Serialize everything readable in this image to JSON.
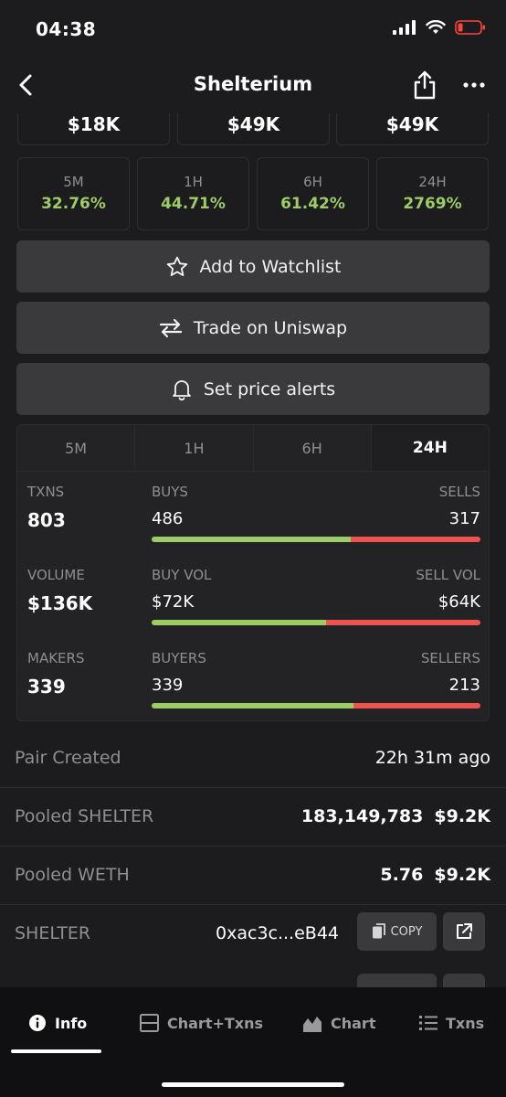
{
  "status_bar": {
    "time": "04:38"
  },
  "header": {
    "title": "Shelterium"
  },
  "prices": [
    "$18K",
    "$49K",
    "$49K"
  ],
  "changes": [
    {
      "label": "5M",
      "value": "32.76%"
    },
    {
      "label": "1H",
      "value": "44.71%"
    },
    {
      "label": "6H",
      "value": "61.42%"
    },
    {
      "label": "24H",
      "value": "2769%"
    }
  ],
  "actions": {
    "watchlist": "Add to Watchlist",
    "trade": "Trade on Uniswap",
    "alerts": "Set price alerts"
  },
  "tx_tabs": [
    "5M",
    "1H",
    "6H",
    "24H"
  ],
  "tx_active_tab": "24H",
  "tx_rows": [
    {
      "left_label": "TXNS",
      "left_value": "803",
      "mid_label": "BUYS",
      "mid_value": "486",
      "right_label": "SELLS",
      "right_value": "317",
      "buy_fraction": 0.605
    },
    {
      "left_label": "VOLUME",
      "left_value": "$136K",
      "mid_label": "BUY VOL",
      "mid_value": "$72K",
      "right_label": "SELL VOL",
      "right_value": "$64K",
      "buy_fraction": 0.53
    },
    {
      "left_label": "MAKERS",
      "left_value": "339",
      "mid_label": "BUYERS",
      "mid_value": "339",
      "right_label": "SELLERS",
      "right_value": "213",
      "buy_fraction": 0.614
    }
  ],
  "info": {
    "pair_created_label": "Pair Created",
    "pair_created_value": "22h 31m ago",
    "pooled_shelter_label": "Pooled SHELTER",
    "pooled_shelter_amount": "183,149,783",
    "pooled_shelter_usd": "$9.2K",
    "pooled_weth_label": "Pooled WETH",
    "pooled_weth_amount": "5.76",
    "pooled_weth_usd": "$9.2K",
    "shelter_label": "SHELTER",
    "shelter_address": "0xac3c...eB44",
    "copy_label": "COPY"
  },
  "bottom_tabs": [
    {
      "label": "Info",
      "icon": "info-icon"
    },
    {
      "label": "Chart+Txns",
      "icon": "split-view-icon"
    },
    {
      "label": "Chart",
      "icon": "area-chart-icon"
    },
    {
      "label": "Txns",
      "icon": "list-icon"
    }
  ],
  "colors": {
    "positive": "#9ccc65",
    "negative": "#ef5350",
    "button": "#3a3a3d",
    "background": "#1c1c1e"
  }
}
